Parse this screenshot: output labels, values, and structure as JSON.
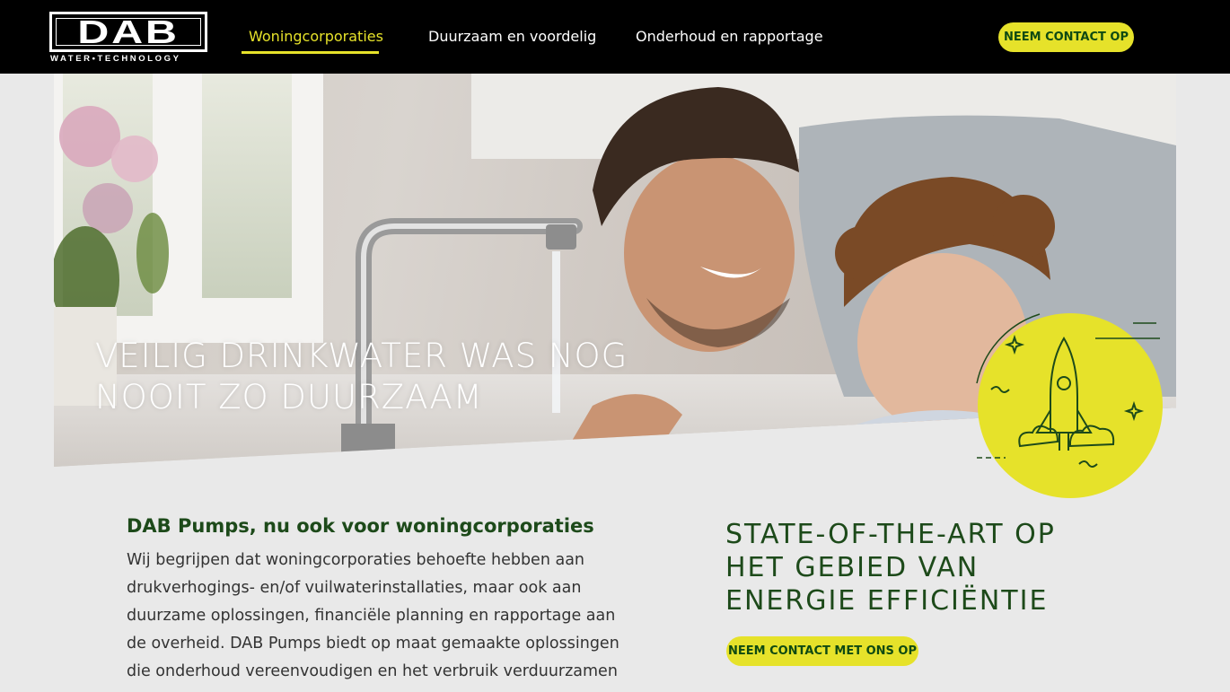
{
  "header": {
    "logo_text": "DAB",
    "logo_tagline": "WATER•TECHNOLOGY",
    "nav": [
      {
        "label": "Woningcorporaties",
        "active": true
      },
      {
        "label": "Duurzaam en voordelig",
        "active": false
      },
      {
        "label": "Onderhoud en rapportage",
        "active": false
      }
    ],
    "cta_label": "NEEM CONTACT OP"
  },
  "hero": {
    "title_lines": [
      "VEILIG DRINKWATER WAS NOG",
      "NOOIT ZO DUURZAAM"
    ],
    "badge_icon": "rocket-icon"
  },
  "main": {
    "heading": "DAB Pumps, nu ook voor woningcorporaties",
    "body_lines": [
      "Wij begrijpen dat woningcorporaties behoefte hebben aan",
      "drukverhogings- en/of vuilwaterinstallaties, maar ook aan",
      "duurzame oplossingen, financiële planning en rapportage aan",
      "de overheid. DAB Pumps biedt op maat gemaakte oplossingen",
      "die onderhoud vereenvoudigen en het verbruik verduurzamen"
    ]
  },
  "aside": {
    "title_lines": [
      "STATE-OF-THE-ART OP",
      "HET GEBIED VAN",
      "ENERGIE EFFICIËNTIE"
    ],
    "cta_label": "NEEM CONTACT MET ONS OP"
  },
  "colors": {
    "accent_yellow": "#e6e22a",
    "dark_green": "#1d4a1a",
    "header_bg": "#000000"
  }
}
